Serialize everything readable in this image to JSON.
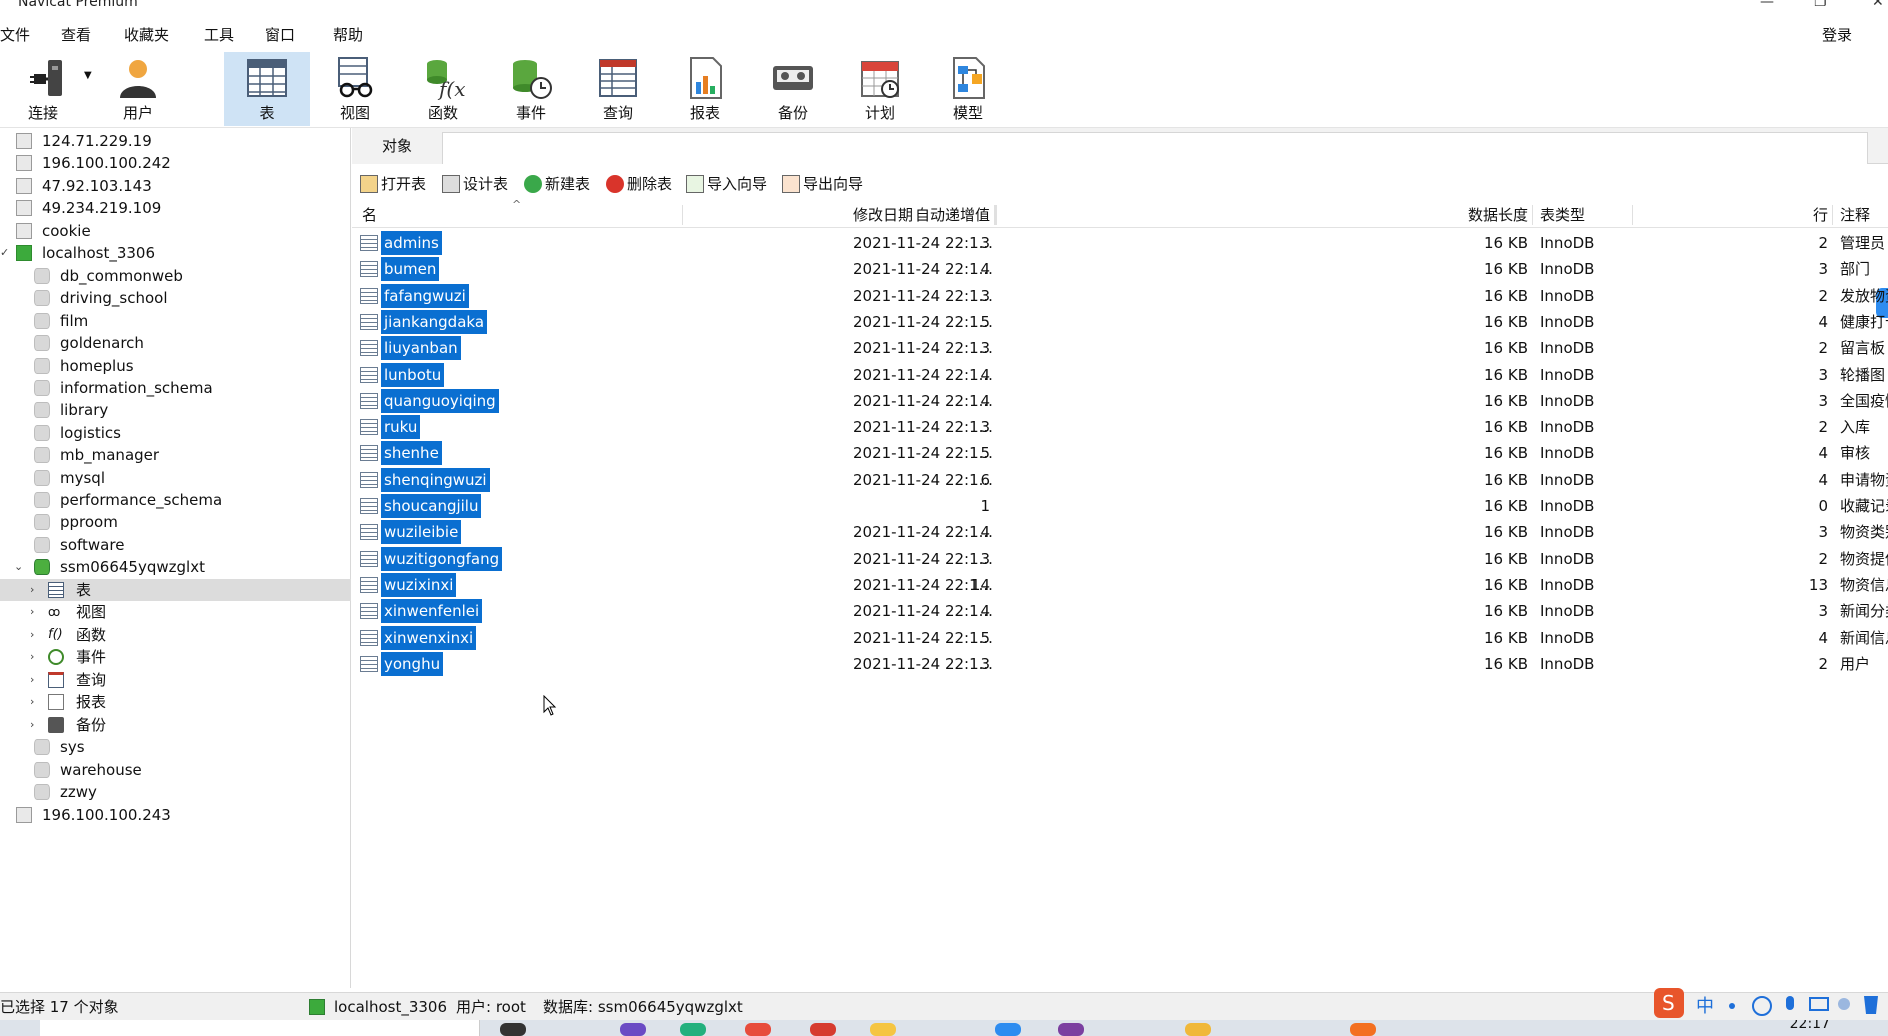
{
  "window": {
    "title": "Navicat Premium",
    "min": "—",
    "max": "❐",
    "close": "✕"
  },
  "menu": {
    "items": [
      "文件",
      "查看",
      "收藏夹",
      "工具",
      "窗口",
      "帮助"
    ],
    "login": "登录"
  },
  "toolbar": {
    "connect": "连接",
    "user": "用户",
    "table": "表",
    "view": "视图",
    "function": "函数",
    "event": "事件",
    "query": "查询",
    "report": "报表",
    "backup": "备份",
    "schedule": "计划",
    "model": "模型"
  },
  "tree": {
    "servers_top": [
      "124.71.229.19",
      "196.100.100.242",
      "47.92.103.143",
      "49.234.219.109",
      "cookie"
    ],
    "localhost": "localhost_3306",
    "dbs_before": [
      "db_commonweb",
      "driving_school",
      "film",
      "goldenarch",
      "homeplus",
      "information_schema",
      "library",
      "logistics",
      "mb_manager",
      "mysql",
      "performance_schema",
      "pproom",
      "software"
    ],
    "active_db": "ssm06645yqwzglxt",
    "db_children": [
      "表",
      "视图",
      "函数",
      "事件",
      "查询",
      "报表",
      "备份"
    ],
    "dbs_after": [
      "sys",
      "warehouse",
      "zzwy"
    ],
    "server_bottom": "196.100.100.243"
  },
  "objects_tab": "对象",
  "actions": {
    "open": "打开表",
    "design": "设计表",
    "new": "新建表",
    "delete": "删除表",
    "import": "导入向导",
    "export": "导出向导"
  },
  "columns": {
    "name": "名",
    "auto_inc": "自动递增值",
    "modified": "修改日期",
    "data_len": "数据长度",
    "engine": "表类型",
    "rows": "行",
    "comment": "注释"
  },
  "tables": [
    {
      "name": "admins",
      "auto_inc": "3",
      "modified": "2021-11-24 22:1...",
      "data_len": "16 KB",
      "engine": "InnoDB",
      "rows": "2",
      "comment": "管理员"
    },
    {
      "name": "bumen",
      "auto_inc": "4",
      "modified": "2021-11-24 22:1...",
      "data_len": "16 KB",
      "engine": "InnoDB",
      "rows": "3",
      "comment": "部门"
    },
    {
      "name": "fafangwuzi",
      "auto_inc": "3",
      "modified": "2021-11-24 22:1...",
      "data_len": "16 KB",
      "engine": "InnoDB",
      "rows": "2",
      "comment": "发放物资"
    },
    {
      "name": "jiankangdaka",
      "auto_inc": "5",
      "modified": "2021-11-24 22:1...",
      "data_len": "16 KB",
      "engine": "InnoDB",
      "rows": "4",
      "comment": "健康打卡"
    },
    {
      "name": "liuyanban",
      "auto_inc": "3",
      "modified": "2021-11-24 22:1...",
      "data_len": "16 KB",
      "engine": "InnoDB",
      "rows": "2",
      "comment": "留言板"
    },
    {
      "name": "lunbotu",
      "auto_inc": "4",
      "modified": "2021-11-24 22:1...",
      "data_len": "16 KB",
      "engine": "InnoDB",
      "rows": "3",
      "comment": "轮播图"
    },
    {
      "name": "quanguoyiqing",
      "auto_inc": "4",
      "modified": "2021-11-24 22:1...",
      "data_len": "16 KB",
      "engine": "InnoDB",
      "rows": "3",
      "comment": "全国疫情"
    },
    {
      "name": "ruku",
      "auto_inc": "3",
      "modified": "2021-11-24 22:1...",
      "data_len": "16 KB",
      "engine": "InnoDB",
      "rows": "2",
      "comment": "入库"
    },
    {
      "name": "shenhe",
      "auto_inc": "5",
      "modified": "2021-11-24 22:1...",
      "data_len": "16 KB",
      "engine": "InnoDB",
      "rows": "4",
      "comment": "审核"
    },
    {
      "name": "shenqingwuzi",
      "auto_inc": "6",
      "modified": "2021-11-24 22:1...",
      "data_len": "16 KB",
      "engine": "InnoDB",
      "rows": "4",
      "comment": "申请物资"
    },
    {
      "name": "shoucangjilu",
      "auto_inc": "1",
      "modified": "",
      "data_len": "16 KB",
      "engine": "InnoDB",
      "rows": "0",
      "comment": "收藏记录"
    },
    {
      "name": "wuzileibie",
      "auto_inc": "4",
      "modified": "2021-11-24 22:1...",
      "data_len": "16 KB",
      "engine": "InnoDB",
      "rows": "3",
      "comment": "物资类别"
    },
    {
      "name": "wuzitigongfang",
      "auto_inc": "3",
      "modified": "2021-11-24 22:1...",
      "data_len": "16 KB",
      "engine": "InnoDB",
      "rows": "2",
      "comment": "物资提供方"
    },
    {
      "name": "wuzixinxi",
      "auto_inc": "14",
      "modified": "2021-11-24 22:1...",
      "data_len": "16 KB",
      "engine": "InnoDB",
      "rows": "13",
      "comment": "物资信息"
    },
    {
      "name": "xinwenfenlei",
      "auto_inc": "4",
      "modified": "2021-11-24 22:1...",
      "data_len": "16 KB",
      "engine": "InnoDB",
      "rows": "3",
      "comment": "新闻分类"
    },
    {
      "name": "xinwenxinxi",
      "auto_inc": "5",
      "modified": "2021-11-24 22:1...",
      "data_len": "16 KB",
      "engine": "InnoDB",
      "rows": "4",
      "comment": "新闻信息"
    },
    {
      "name": "yonghu",
      "auto_inc": "3",
      "modified": "2021-11-24 22:1...",
      "data_len": "16 KB",
      "engine": "InnoDB",
      "rows": "2",
      "comment": "用户"
    }
  ],
  "status": {
    "selected": "已选择 17 个对象",
    "connection": "localhost_3306",
    "user": "用户: root",
    "database": "数据库: ssm06645yqwzglxt"
  },
  "clock": "22:17",
  "colors": {
    "accent": "#0a6fd1",
    "selection_bg": "#cfe3f5",
    "sidebar_sel": "#dcdcdc"
  }
}
